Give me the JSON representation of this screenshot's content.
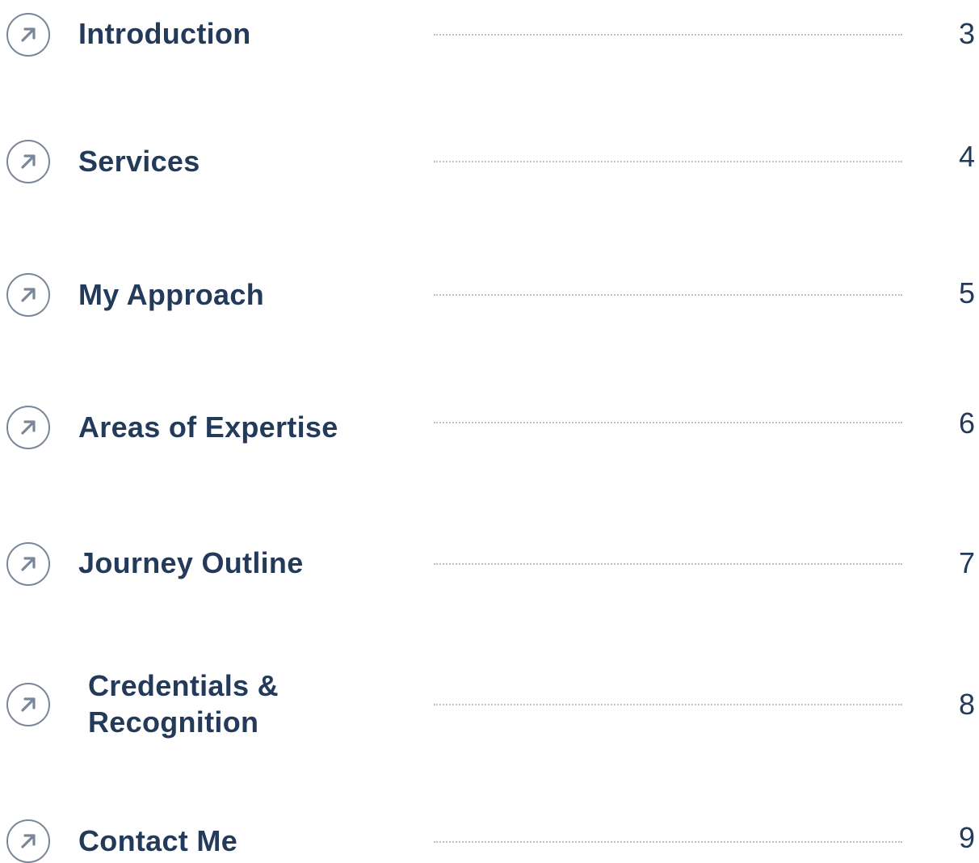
{
  "toc": {
    "items": [
      {
        "label": "Introduction",
        "page": "3",
        "icon": "arrow-up-right-icon"
      },
      {
        "label": "Services",
        "page": "4",
        "icon": "arrow-up-right-icon"
      },
      {
        "label": "My Approach",
        "page": "5",
        "icon": "arrow-up-right-icon"
      },
      {
        "label": "Areas of Expertise",
        "page": "6",
        "icon": "arrow-up-right-icon"
      },
      {
        "label": "Journey Outline",
        "page": "7",
        "icon": "arrow-up-right-icon"
      },
      {
        "label": "Credentials & Recognition",
        "page": "8",
        "icon": "arrow-up-right-icon"
      },
      {
        "label": "Contact Me",
        "page": "9",
        "icon": "arrow-up-right-icon"
      }
    ]
  },
  "colors": {
    "text": "#233a5a",
    "icon_stroke": "#7a8799",
    "leader": "#b9c0cb",
    "background": "#ffffff"
  }
}
